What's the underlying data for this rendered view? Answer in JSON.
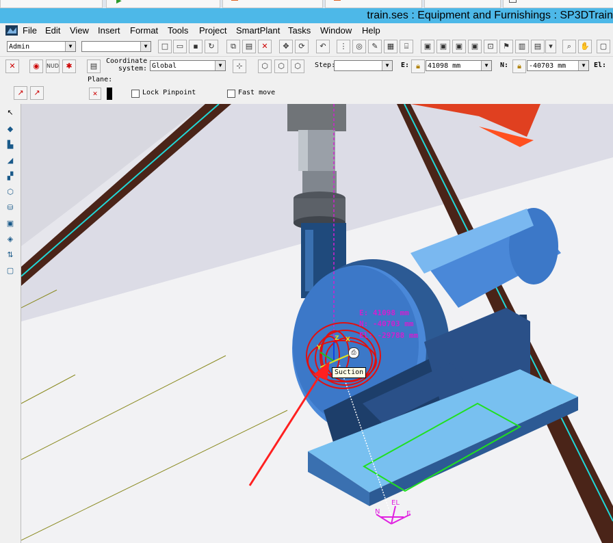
{
  "window": {
    "title": "train.ses : Equipment and Furnishings : SP3DTrain"
  },
  "menu": [
    "File",
    "Edit",
    "View",
    "Insert",
    "Format",
    "Tools",
    "Project",
    "SmartPlant",
    "Tasks",
    "Window",
    "Help"
  ],
  "toolbar1": {
    "permission_group": "Admin",
    "filter_combo": ""
  },
  "toolbar2": {
    "coordinate_system_label": "Coordinate system:",
    "coordinate_system_value": "Global",
    "step_label": "Step:",
    "step_value": "",
    "e_label": "E:",
    "e_value": "41098 mm",
    "n_label": "N:",
    "n_value": "-40703 mm",
    "el_label": "El:"
  },
  "toolbar3": {
    "plane_label": "Plane:",
    "lock_pinpoint": "Lock Pinpoint",
    "fast_move": "Fast move"
  },
  "viewport": {
    "readout_e": "E: 41098 mm",
    "readout_n": "N: -40703 mm",
    "readout_el": "El: -29788 mm",
    "tooltip": "Suction",
    "axis_x": "X",
    "axis_y": "Y",
    "axis_z": "Z",
    "compass_n": "N",
    "compass_e": "E",
    "compass_el": "EL"
  },
  "colors": {
    "titlebar": "#4db8e8",
    "equipment_blue": "#3c78c8",
    "base_light_blue": "#78c0f0",
    "steel_beam": "#5a2a1a",
    "highlight_red": "#e01010",
    "pinpoint_magenta": "#d020d0",
    "outline_green": "#20e020"
  }
}
